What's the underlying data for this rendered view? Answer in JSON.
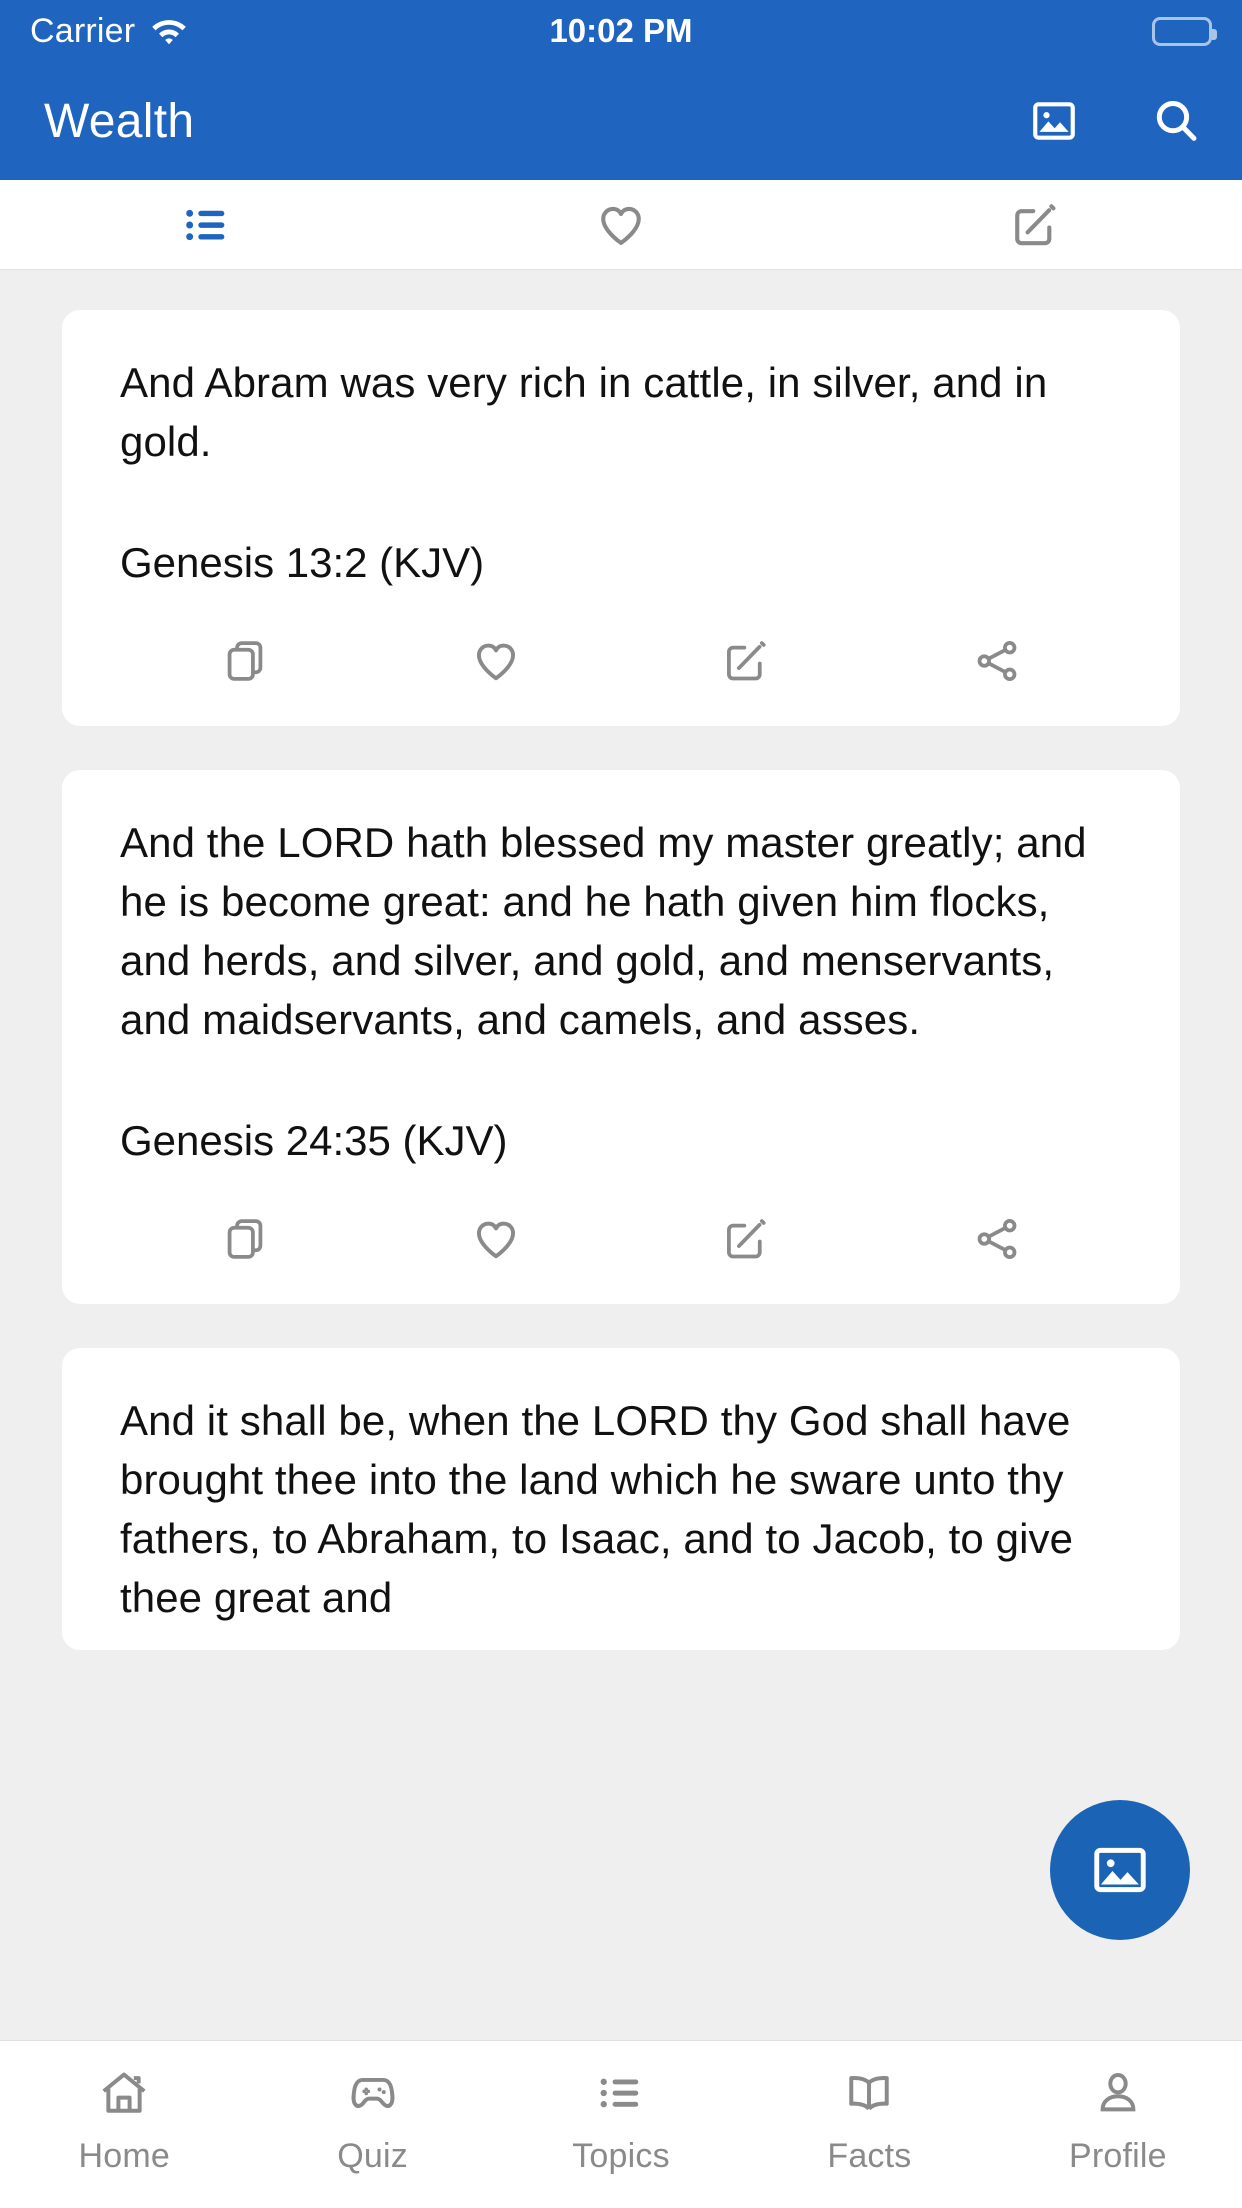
{
  "status_bar": {
    "carrier": "Carrier",
    "wifi_icon": "wifi-icon",
    "time": "10:02 PM",
    "battery_icon": "battery-full-icon"
  },
  "app_bar": {
    "title": "Wealth",
    "actions": [
      {
        "name": "image-icon",
        "label": "Image"
      },
      {
        "name": "search-icon",
        "label": "Search"
      }
    ]
  },
  "segment_tabs": {
    "active_index": 0,
    "items": [
      {
        "name": "tab-list",
        "icon": "list-icon",
        "label": "List",
        "active": true
      },
      {
        "name": "tab-favorites",
        "icon": "heart-icon",
        "label": "Favorites",
        "active": false
      },
      {
        "name": "tab-notes",
        "icon": "edit-square-icon",
        "label": "Notes",
        "active": false
      }
    ]
  },
  "card_actions": [
    {
      "name": "copy-action",
      "icon": "copy-icon",
      "label": "Copy"
    },
    {
      "name": "favorite-action",
      "icon": "heart-icon",
      "label": "Favorite"
    },
    {
      "name": "edit-action",
      "icon": "edit-square-icon",
      "label": "Edit"
    },
    {
      "name": "share-action",
      "icon": "share-icon",
      "label": "Share"
    }
  ],
  "verses": [
    {
      "text": "And Abram was very rich in cattle, in silver, and in gold.",
      "reference": "Genesis 13:2 (KJV)"
    },
    {
      "text": "And the LORD hath blessed my master greatly; and he is become great: and he hath given him flocks, and herds, and silver, and gold, and menservants, and maidservants, and camels, and asses.",
      "reference": "Genesis 24:35 (KJV)"
    },
    {
      "text": "And it shall be, when the LORD thy God shall have brought thee into the land which he sware unto thy fathers, to Abraham, to Isaac, and to Jacob, to give thee great and",
      "reference": ""
    }
  ],
  "fab": {
    "name": "image-fab",
    "icon": "image-icon",
    "label": "Image",
    "color": "#1B64B5"
  },
  "bottom_nav": {
    "active_index": -1,
    "items": [
      {
        "name": "nav-home",
        "icon": "home-icon",
        "label": "Home"
      },
      {
        "name": "nav-quiz",
        "icon": "gamepad-icon",
        "label": "Quiz"
      },
      {
        "name": "nav-topics",
        "icon": "list-icon",
        "label": "Topics"
      },
      {
        "name": "nav-facts",
        "icon": "book-icon",
        "label": "Facts"
      },
      {
        "name": "nav-profile",
        "icon": "person-icon",
        "label": "Profile"
      }
    ]
  },
  "colors": {
    "header_blue": "#1F64BE",
    "accent_blue": "#1B64B5",
    "page_background": "#EFEFEF",
    "card_background": "#FFFFFF",
    "icon_gray": "#8A8A8A",
    "text_primary": "#111111"
  }
}
